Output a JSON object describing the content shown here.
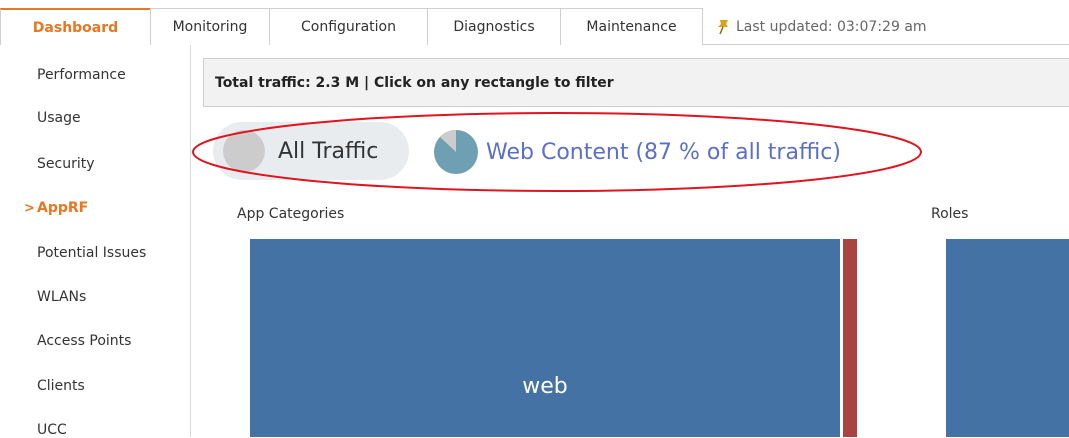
{
  "tabs": [
    {
      "label": "Dashboard",
      "active": true
    },
    {
      "label": "Monitoring",
      "active": false
    },
    {
      "label": "Configuration",
      "active": false
    },
    {
      "label": "Diagnostics",
      "active": false
    },
    {
      "label": "Maintenance",
      "active": false
    }
  ],
  "status": {
    "last_updated": "Last updated: 03:07:29 am",
    "icon": "pushpin-icon"
  },
  "sidebar": {
    "items": [
      {
        "label": "Performance",
        "active": false
      },
      {
        "label": "Usage",
        "active": false
      },
      {
        "label": "Security",
        "active": false
      },
      {
        "label": "AppRF",
        "active": true
      },
      {
        "label": "Potential Issues",
        "active": false
      },
      {
        "label": "WLANs",
        "active": false
      },
      {
        "label": "Access Points",
        "active": false
      },
      {
        "label": "Clients",
        "active": false
      },
      {
        "label": "UCC",
        "active": false
      }
    ],
    "active_marker": ">"
  },
  "main": {
    "filter_text": "Total traffic: 2.3 M | Click on any rectangle to filter",
    "breadcrumbs": [
      {
        "label": "All Traffic"
      },
      {
        "label": "Web Content (87 % of all traffic)",
        "share_percent": 87
      }
    ],
    "sections": {
      "app_categories_title": "App Categories",
      "roles_title": "Roles"
    },
    "treemap": {
      "web_label": "web"
    }
  },
  "colors": {
    "accent": "#e87722",
    "treemap_blue": "#4472a4",
    "treemap_red": "#a94442",
    "link": "#5b6fc7",
    "highlight_ellipse": "#e0141e"
  }
}
